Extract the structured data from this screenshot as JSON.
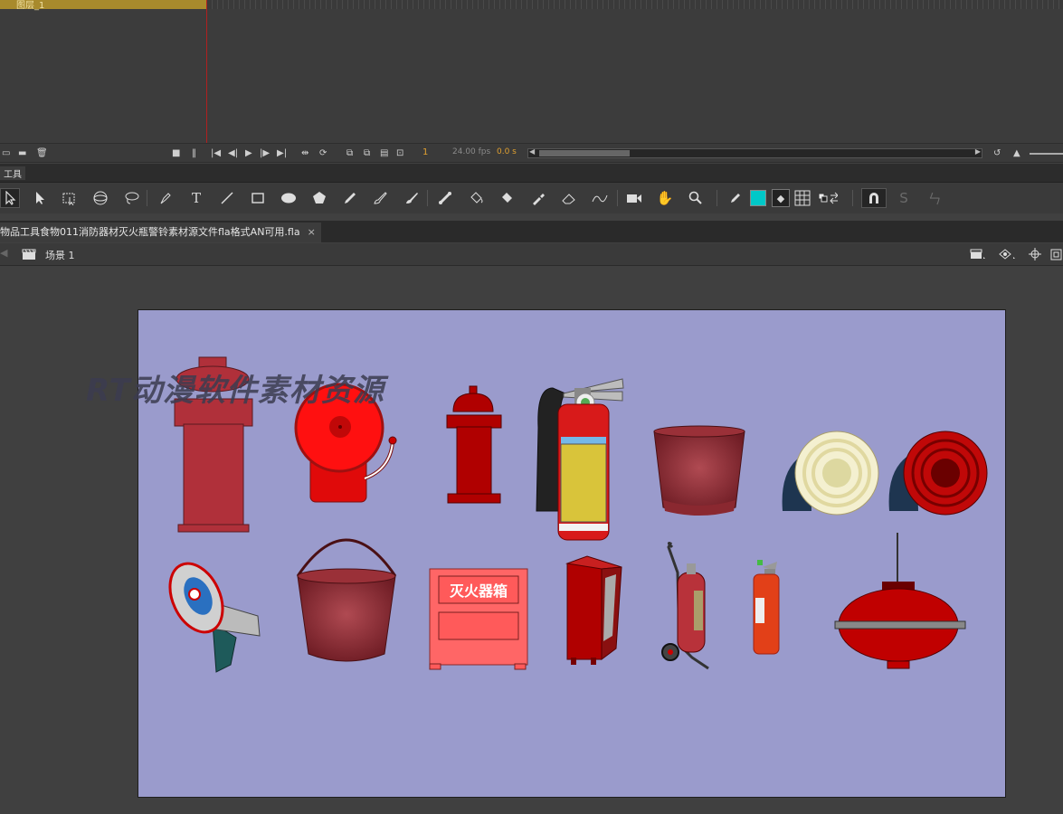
{
  "timeline": {
    "layer_name": "图层_1",
    "current_frame": "1",
    "fps": "24.00 fps",
    "seconds": "0.0 s"
  },
  "tools_panel": {
    "title": "工具"
  },
  "toolbar": {
    "fill_color": "#00c8c8",
    "tools": [
      "selection-icon",
      "subselection-icon",
      "free-transform-icon",
      "3d-rotation-icon",
      "lasso-icon",
      "pen-icon",
      "text-icon",
      "line-icon",
      "rectangle-icon",
      "oval-icon",
      "polystar-icon",
      "pencil-icon",
      "paint-brush-icon",
      "brush-icon",
      "bone-icon",
      "paint-bucket-icon",
      "ink-bottle-icon",
      "eyedropper-icon",
      "eraser-icon",
      "width-icon",
      "camera-icon",
      "hand-icon",
      "zoom-icon"
    ]
  },
  "document": {
    "tab_title": "物品工具食物011消防器材灭火瓶警铃素材源文件fla格式AN可用.fla",
    "close_glyph": "×",
    "scene": "场景 1"
  },
  "stage": {
    "background": "#9a9bcc",
    "watermark": "RT动漫软件素材资源",
    "cabinet_label": "灭火器箱"
  }
}
